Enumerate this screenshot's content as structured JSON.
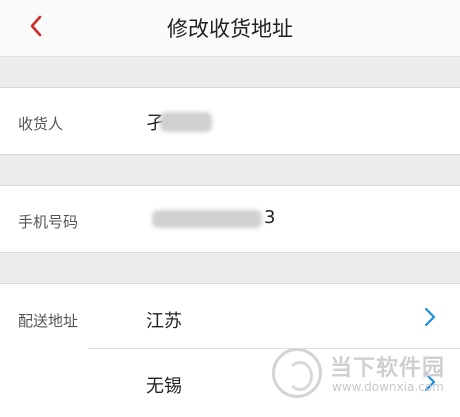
{
  "header": {
    "title": "修改收货地址",
    "back_icon": "chevron-left-icon",
    "accent": "#d12a2a"
  },
  "form": {
    "receiver": {
      "label": "收货人",
      "value_visible": "孑"
    },
    "phone": {
      "label": "手机号码",
      "value_visible": "3"
    },
    "address": {
      "label": "配送地址",
      "province": "江苏",
      "city": "无锡",
      "chevron_color": "#1a8fe0"
    }
  },
  "watermark": {
    "name": "当下软件园",
    "url": "www.downxia.com"
  }
}
